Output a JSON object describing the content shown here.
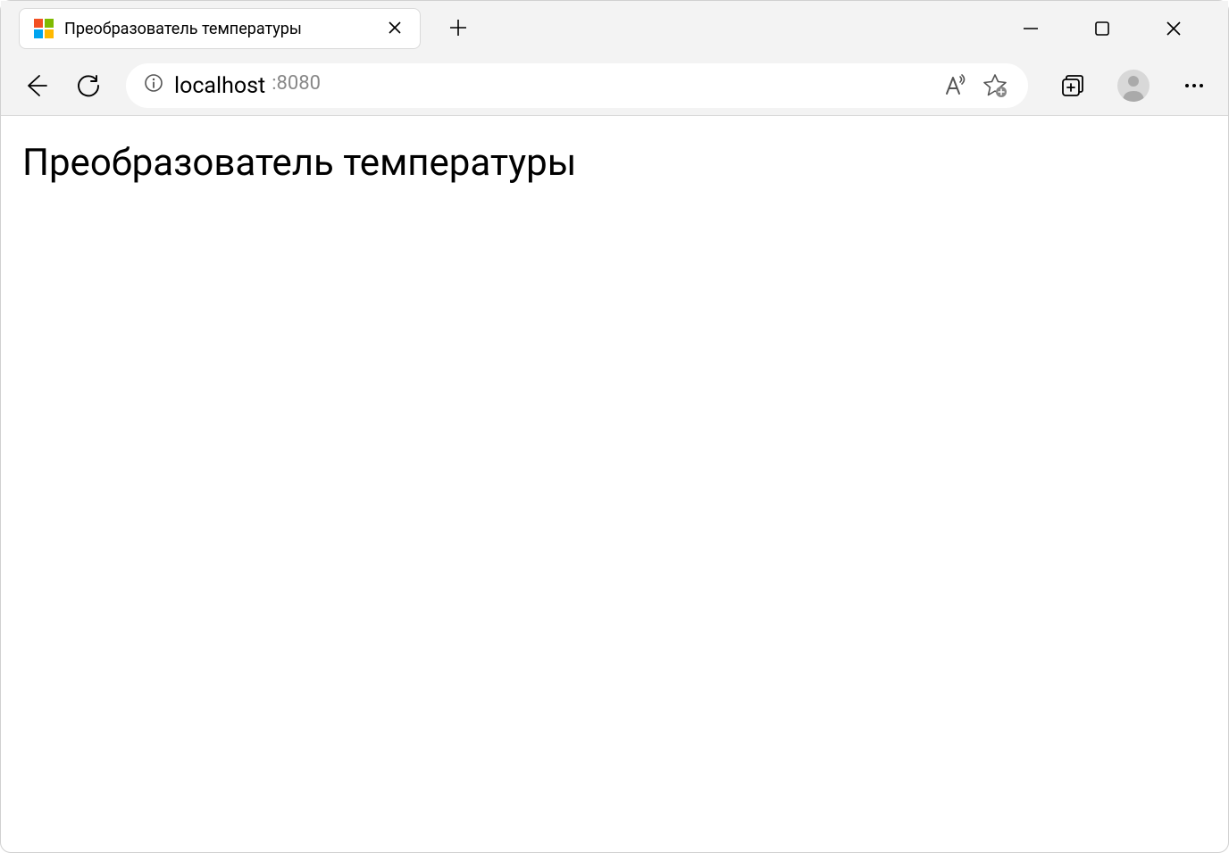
{
  "tab": {
    "title": "Преобразователь температуры"
  },
  "addressBar": {
    "host": "localhost",
    "port": ":8080"
  },
  "page": {
    "heading": "Преобразователь температуры"
  }
}
